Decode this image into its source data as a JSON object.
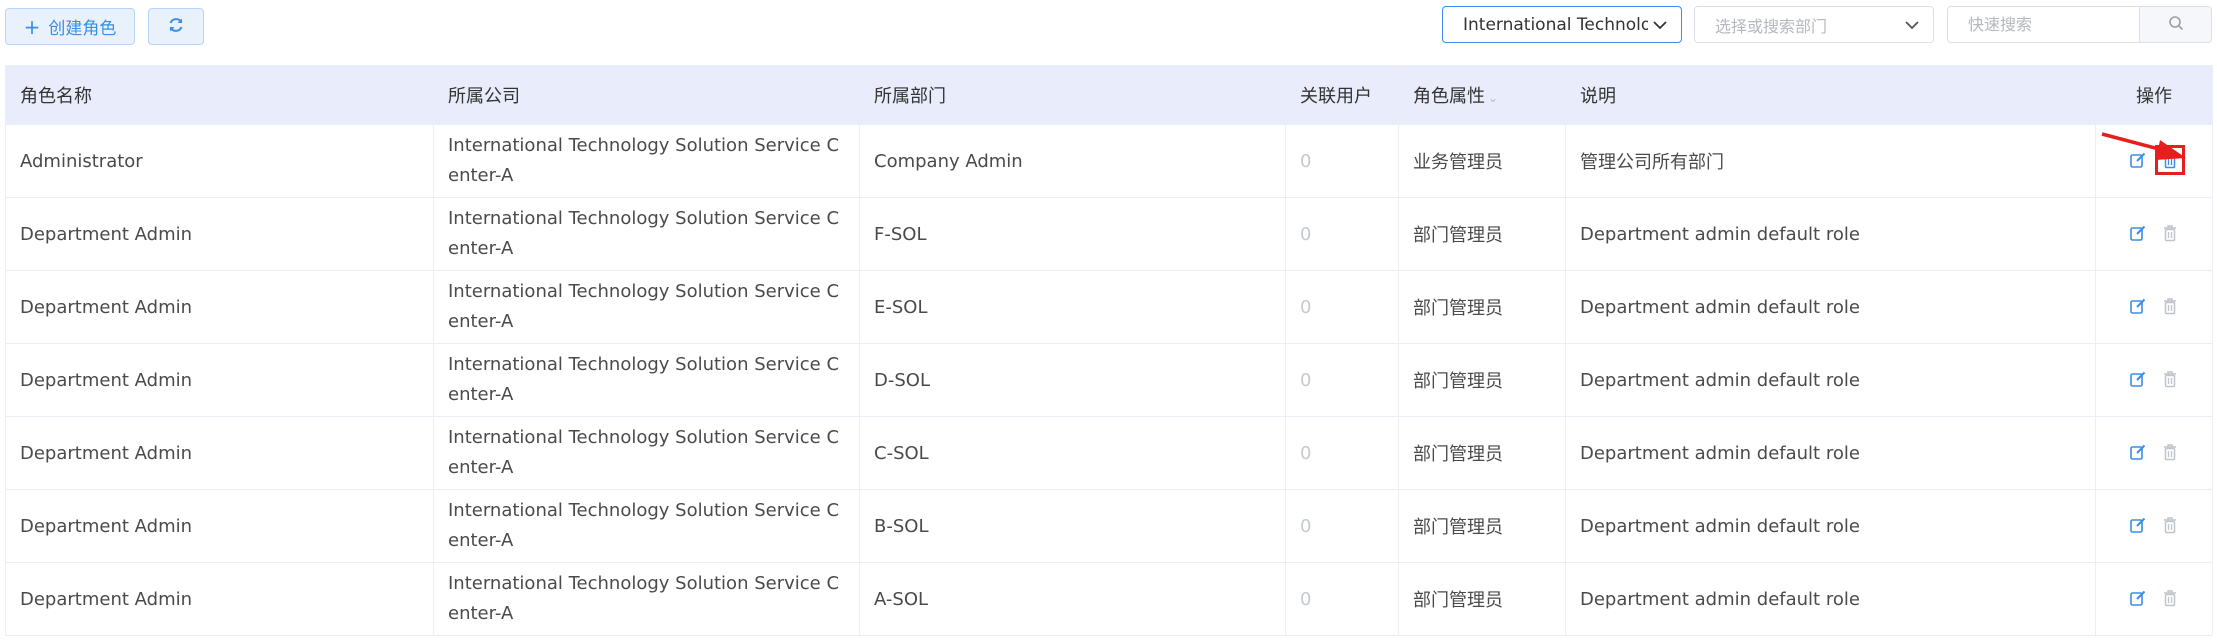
{
  "toolbar": {
    "create_label": "创建角色",
    "company_select_value": "International Technology Solution Service Center-A",
    "dept_select_placeholder": "选择或搜索部门",
    "search_placeholder": "快速搜索"
  },
  "table": {
    "headers": {
      "role_name": "角色名称",
      "company": "所属公司",
      "department": "所属部门",
      "users": "关联用户",
      "attribute": "角色属性",
      "description": "说明",
      "actions": "操作"
    },
    "rows": [
      {
        "role_name": "Administrator",
        "company": "International Technology Solution Service Center-A",
        "department": "Company Admin",
        "users": "0",
        "attribute": "业务管理员",
        "description": "管理公司所有部门"
      },
      {
        "role_name": "Department Admin",
        "company": "International Technology Solution Service Center-A",
        "department": "F-SOL",
        "users": "0",
        "attribute": "部门管理员",
        "description": "Department admin default role"
      },
      {
        "role_name": "Department Admin",
        "company": "International Technology Solution Service Center-A",
        "department": "E-SOL",
        "users": "0",
        "attribute": "部门管理员",
        "description": "Department admin default role"
      },
      {
        "role_name": "Department Admin",
        "company": "International Technology Solution Service Center-A",
        "department": "D-SOL",
        "users": "0",
        "attribute": "部门管理员",
        "description": "Department admin default role"
      },
      {
        "role_name": "Department Admin",
        "company": "International Technology Solution Service Center-A",
        "department": "C-SOL",
        "users": "0",
        "attribute": "部门管理员",
        "description": "Department admin default role"
      },
      {
        "role_name": "Department Admin",
        "company": "International Technology Solution Service Center-A",
        "department": "B-SOL",
        "users": "0",
        "attribute": "部门管理员",
        "description": "Department admin default role"
      },
      {
        "role_name": "Department Admin",
        "company": "International Technology Solution Service Center-A",
        "department": "A-SOL",
        "users": "0",
        "attribute": "部门管理员",
        "description": "Department admin default role"
      }
    ]
  },
  "colors": {
    "accent": "#3a8ee6",
    "header_bg": "#e9edfb",
    "highlight": "#e81e1e",
    "disabled_icon": "#c0c4cc"
  },
  "icons": [
    "plus-icon",
    "refresh-icon",
    "chevron-down-icon",
    "search-icon",
    "edit-icon",
    "delete-icon",
    "annotation-arrow"
  ]
}
